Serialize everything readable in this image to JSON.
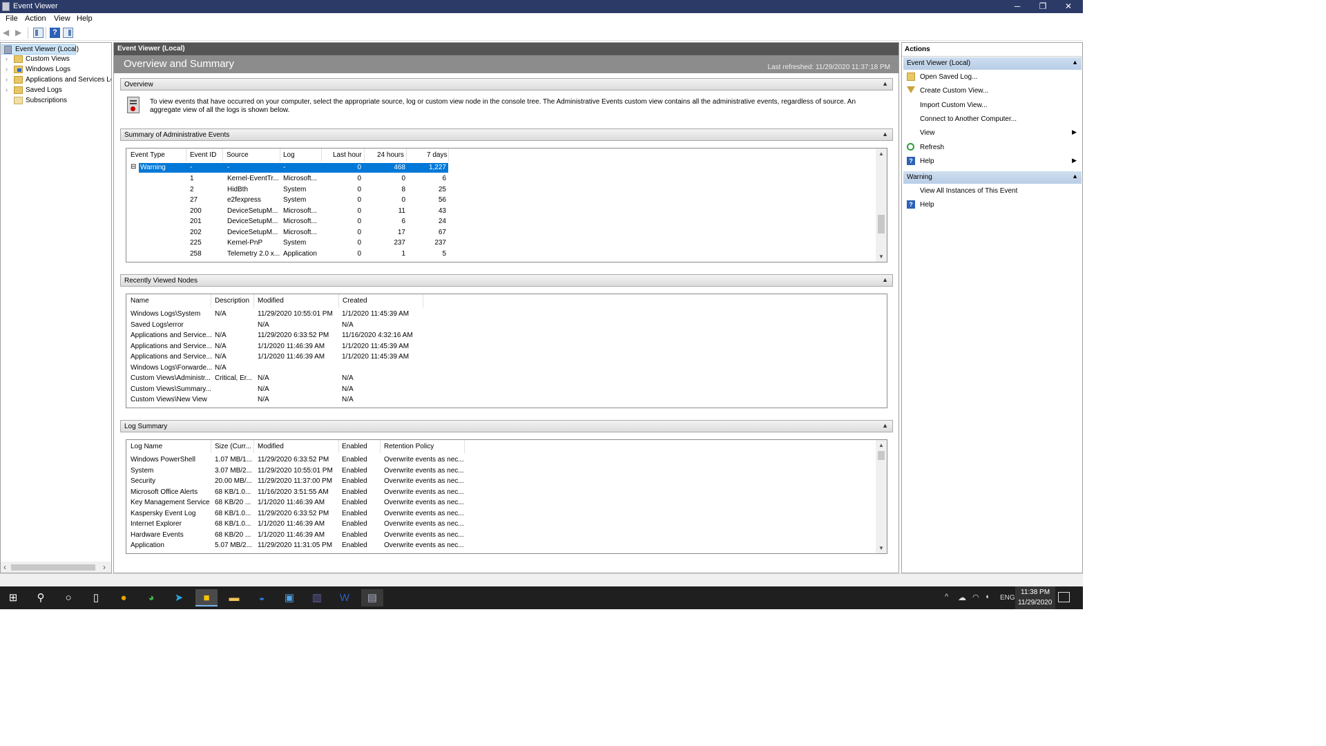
{
  "window": {
    "title": "Event Viewer",
    "minimize": "─",
    "restore": "❐",
    "close": "✕"
  },
  "menu": [
    "File",
    "Action",
    "View",
    "Help"
  ],
  "toolbar": {
    "back": "◀",
    "forward": "▶"
  },
  "tree": {
    "items": [
      {
        "label": "Event Viewer (Local)",
        "expander": ""
      },
      {
        "label": "Custom Views",
        "expander": "›"
      },
      {
        "label": "Windows Logs",
        "expander": "›"
      },
      {
        "label": "Applications and Services Lo",
        "expander": "›"
      },
      {
        "label": "Saved Logs",
        "expander": "›"
      },
      {
        "label": "Subscriptions",
        "expander": ""
      }
    ],
    "scroll_left": "‹",
    "scroll_right": "›"
  },
  "center": {
    "header": "Event Viewer (Local)",
    "band_title": "Overview and Summary",
    "last_refreshed": "Last refreshed: 11/29/2020 11:37:18 PM",
    "overview": {
      "title": "Overview",
      "text": "To view events that have occurred on your computer, select the appropriate source, log or custom view node in the console tree. The Administrative Events custom view contains all the administrative events, regardless of source. An aggregate view of all the logs is shown below."
    },
    "summary": {
      "title": "Summary of Administrative Events",
      "columns": [
        "Event Type",
        "Event ID",
        "Source",
        "Log",
        "Last hour",
        "24 hours",
        "7 days"
      ],
      "group": {
        "toggle": "⊟",
        "type": "Warning",
        "id": "-",
        "source": "-",
        "log": "-",
        "hour": "0",
        "day": "468",
        "week": "1,227"
      },
      "rows": [
        {
          "id": "1",
          "source": "Kernel-EventTr...",
          "log": "Microsoft...",
          "hour": "0",
          "day": "0",
          "week": "6"
        },
        {
          "id": "2",
          "source": "HidBth",
          "log": "System",
          "hour": "0",
          "day": "8",
          "week": "25"
        },
        {
          "id": "27",
          "source": "e2fexpress",
          "log": "System",
          "hour": "0",
          "day": "0",
          "week": "56"
        },
        {
          "id": "200",
          "source": "DeviceSetupM...",
          "log": "Microsoft...",
          "hour": "0",
          "day": "11",
          "week": "43"
        },
        {
          "id": "201",
          "source": "DeviceSetupM...",
          "log": "Microsoft...",
          "hour": "0",
          "day": "6",
          "week": "24"
        },
        {
          "id": "202",
          "source": "DeviceSetupM...",
          "log": "Microsoft...",
          "hour": "0",
          "day": "17",
          "week": "67"
        },
        {
          "id": "225",
          "source": "Kernel-PnP",
          "log": "System",
          "hour": "0",
          "day": "237",
          "week": "237"
        },
        {
          "id": "258",
          "source": "Telemetry 2.0 x...",
          "log": "Application",
          "hour": "0",
          "day": "1",
          "week": "5"
        }
      ]
    },
    "recent": {
      "title": "Recently Viewed Nodes",
      "columns": [
        "Name",
        "Description",
        "Modified",
        "Created"
      ],
      "rows": [
        {
          "name": "Windows Logs\\System",
          "desc": "N/A",
          "modified": "11/29/2020 10:55:01 PM",
          "created": "1/1/2020 11:45:39 AM"
        },
        {
          "name": "Saved Logs\\error",
          "desc": "",
          "modified": "N/A",
          "created": "N/A"
        },
        {
          "name": "Applications and Service...",
          "desc": "N/A",
          "modified": "11/29/2020 6:33:52 PM",
          "created": "11/16/2020 4:32:16 AM"
        },
        {
          "name": "Applications and Service...",
          "desc": "N/A",
          "modified": "1/1/2020 11:46:39 AM",
          "created": "1/1/2020 11:45:39 AM"
        },
        {
          "name": "Applications and Service...",
          "desc": "N/A",
          "modified": "1/1/2020 11:46:39 AM",
          "created": "1/1/2020 11:45:39 AM"
        },
        {
          "name": "Windows Logs\\Forwarde...",
          "desc": "N/A",
          "modified": "",
          "created": ""
        },
        {
          "name": "Custom Views\\Administr...",
          "desc": "Critical, Er...",
          "modified": "N/A",
          "created": "N/A"
        },
        {
          "name": "Custom Views\\Summary...",
          "desc": "",
          "modified": "N/A",
          "created": "N/A"
        },
        {
          "name": "Custom Views\\New View",
          "desc": "",
          "modified": "N/A",
          "created": "N/A"
        }
      ]
    },
    "logsummary": {
      "title": "Log Summary",
      "columns": [
        "Log Name",
        "Size (Curr...",
        "Modified",
        "Enabled",
        "Retention Policy"
      ],
      "rows": [
        {
          "name": "Windows PowerShell",
          "size": "1.07 MB/1...",
          "modified": "11/29/2020 6:33:52 PM",
          "enabled": "Enabled",
          "policy": "Overwrite events as nec..."
        },
        {
          "name": "System",
          "size": "3.07 MB/2...",
          "modified": "11/29/2020 10:55:01 PM",
          "enabled": "Enabled",
          "policy": "Overwrite events as nec..."
        },
        {
          "name": "Security",
          "size": "20.00 MB/...",
          "modified": "11/29/2020 11:37:00 PM",
          "enabled": "Enabled",
          "policy": "Overwrite events as nec..."
        },
        {
          "name": "Microsoft Office Alerts",
          "size": "68 KB/1.0...",
          "modified": "11/16/2020 3:51:55 AM",
          "enabled": "Enabled",
          "policy": "Overwrite events as nec..."
        },
        {
          "name": "Key Management Service",
          "size": "68 KB/20 ...",
          "modified": "1/1/2020 11:46:39 AM",
          "enabled": "Enabled",
          "policy": "Overwrite events as nec..."
        },
        {
          "name": "Kaspersky Event Log",
          "size": "68 KB/1.0...",
          "modified": "11/29/2020 6:33:52 PM",
          "enabled": "Enabled",
          "policy": "Overwrite events as nec..."
        },
        {
          "name": "Internet Explorer",
          "size": "68 KB/1.0...",
          "modified": "1/1/2020 11:46:39 AM",
          "enabled": "Enabled",
          "policy": "Overwrite events as nec..."
        },
        {
          "name": "Hardware Events",
          "size": "68 KB/20 ...",
          "modified": "1/1/2020 11:46:39 AM",
          "enabled": "Enabled",
          "policy": "Overwrite events as nec..."
        },
        {
          "name": "Application",
          "size": "5.07 MB/2...",
          "modified": "11/29/2020 11:31:05 PM",
          "enabled": "Enabled",
          "policy": "Overwrite events as nec..."
        }
      ]
    },
    "collapse_glyph": "▲",
    "scroll_up": "▲",
    "scroll_down": "▼"
  },
  "actions": {
    "title": "Actions",
    "group1": {
      "label": "Event Viewer (Local)",
      "caret": "▲"
    },
    "items1": [
      {
        "label": "Open Saved Log...",
        "icon": "folder-icon",
        "sub": ""
      },
      {
        "label": "Create Custom View...",
        "icon": "filter-icon",
        "sub": ""
      },
      {
        "label": "Import Custom View...",
        "icon": "",
        "sub": ""
      },
      {
        "label": "Connect to Another Computer...",
        "icon": "",
        "sub": ""
      },
      {
        "label": "View",
        "icon": "",
        "sub": "▶"
      },
      {
        "label": "Refresh",
        "icon": "refresh-icon",
        "sub": ""
      },
      {
        "label": "Help",
        "icon": "help-icon",
        "sub": "▶"
      }
    ],
    "group2": {
      "label": "Warning",
      "caret": "▲"
    },
    "items2": [
      {
        "label": "View All Instances of This Event",
        "icon": "",
        "sub": ""
      },
      {
        "label": "Help",
        "icon": "help-icon",
        "sub": ""
      }
    ]
  },
  "taskbar": {
    "apps": [
      "start-icon",
      "search-icon",
      "cortana-icon",
      "task-view-icon",
      "chrome-icon",
      "edge-icon",
      "telegram-icon",
      "sticky-notes-icon",
      "file-explorer-icon",
      "app-icon",
      "control-panel-icon",
      "teams-icon",
      "word-icon",
      "event-viewer-icon"
    ],
    "tray": {
      "chevron": "^",
      "lang": "ENG",
      "time": "11:38 PM",
      "date": "11/29/2020"
    }
  },
  "colors": {
    "titlebar": "#2b3a67",
    "selection": "#0078d7",
    "section_header": "#dcdcdc",
    "actions_group": "#c6d9ef",
    "taskbar": "#1f1f1f"
  }
}
